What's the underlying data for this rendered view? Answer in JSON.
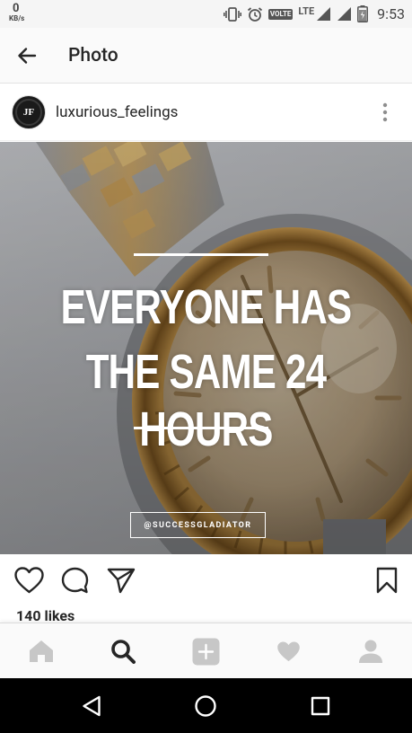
{
  "status_bar": {
    "speed_value": "0",
    "speed_unit": "KB/s",
    "network": "LTE",
    "volte": "VOLTE",
    "time": "9:53"
  },
  "app_bar": {
    "title": "Photo"
  },
  "post": {
    "username": "luxurious_feelings",
    "avatar_text": "JF",
    "image": {
      "line1": "EVERYONE HAS",
      "line2": "THE SAME 24 HOURS",
      "tag": "@SUCCESSGLADIATOR"
    },
    "likes": "140 likes"
  },
  "colors": {
    "text_primary": "#262626",
    "tab_inactive": "#c7c7c7",
    "tab_active": "#262626",
    "nav_background": "#000000"
  }
}
